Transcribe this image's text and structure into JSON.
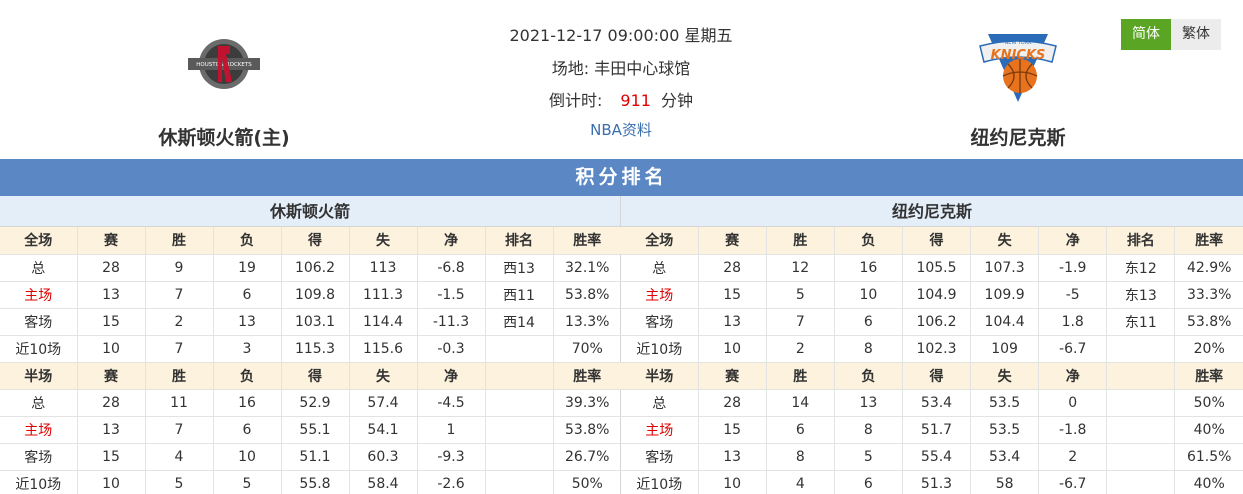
{
  "header": {
    "home_team": "休斯顿火箭(主)",
    "away_team": "纽约尼克斯",
    "datetime": "2021-12-17 09:00:00 星期五",
    "venue_label": "场地:",
    "venue": "丰田中心球馆",
    "countdown_label": "倒计时:",
    "countdown_value": "911",
    "countdown_unit": "分钟",
    "nba_link": "NBA资料",
    "home_logo_text": "HOUSTON ROCKETS",
    "away_logo_text_top": "NEW YORK",
    "away_logo_text": "KNICKS"
  },
  "lang": {
    "simplified": "简体",
    "traditional": "繁体"
  },
  "colors": {
    "accent_green": "#5aa624",
    "header_blue": "#5b88c5",
    "red": "#e00000"
  },
  "standings": {
    "title": "积分排名",
    "home": {
      "name": "休斯顿火箭",
      "full_headers": [
        "全场",
        "赛",
        "胜",
        "负",
        "得",
        "失",
        "净",
        "排名",
        "胜率"
      ],
      "full_rows": [
        [
          "总",
          "28",
          "9",
          "19",
          "106.2",
          "113",
          "-6.8",
          "西13",
          "32.1%"
        ],
        [
          "主场",
          "13",
          "7",
          "6",
          "109.8",
          "111.3",
          "-1.5",
          "西11",
          "53.8%"
        ],
        [
          "客场",
          "15",
          "2",
          "13",
          "103.1",
          "114.4",
          "-11.3",
          "西14",
          "13.3%"
        ],
        [
          "近10场",
          "10",
          "7",
          "3",
          "115.3",
          "115.6",
          "-0.3",
          "",
          "70%"
        ]
      ],
      "half_headers": [
        "半场",
        "赛",
        "胜",
        "负",
        "得",
        "失",
        "净",
        "",
        "胜率"
      ],
      "half_rows": [
        [
          "总",
          "28",
          "11",
          "16",
          "52.9",
          "57.4",
          "-4.5",
          "",
          "39.3%"
        ],
        [
          "主场",
          "13",
          "7",
          "6",
          "55.1",
          "54.1",
          "1",
          "",
          "53.8%"
        ],
        [
          "客场",
          "15",
          "4",
          "10",
          "51.1",
          "60.3",
          "-9.3",
          "",
          "26.7%"
        ],
        [
          "近10场",
          "10",
          "5",
          "5",
          "55.8",
          "58.4",
          "-2.6",
          "",
          "50%"
        ]
      ]
    },
    "away": {
      "name": "纽约尼克斯",
      "full_headers": [
        "全场",
        "赛",
        "胜",
        "负",
        "得",
        "失",
        "净",
        "排名",
        "胜率"
      ],
      "full_rows": [
        [
          "总",
          "28",
          "12",
          "16",
          "105.5",
          "107.3",
          "-1.9",
          "东12",
          "42.9%"
        ],
        [
          "主场",
          "15",
          "5",
          "10",
          "104.9",
          "109.9",
          "-5",
          "东13",
          "33.3%"
        ],
        [
          "客场",
          "13",
          "7",
          "6",
          "106.2",
          "104.4",
          "1.8",
          "东11",
          "53.8%"
        ],
        [
          "近10场",
          "10",
          "2",
          "8",
          "102.3",
          "109",
          "-6.7",
          "",
          "20%"
        ]
      ],
      "half_headers": [
        "半场",
        "赛",
        "胜",
        "负",
        "得",
        "失",
        "净",
        "",
        "胜率"
      ],
      "half_rows": [
        [
          "总",
          "28",
          "14",
          "13",
          "53.4",
          "53.5",
          "0",
          "",
          "50%"
        ],
        [
          "主场",
          "15",
          "6",
          "8",
          "51.7",
          "53.5",
          "-1.8",
          "",
          "40%"
        ],
        [
          "客场",
          "13",
          "8",
          "5",
          "55.4",
          "53.4",
          "2",
          "",
          "61.5%"
        ],
        [
          "近10场",
          "10",
          "4",
          "6",
          "51.3",
          "58",
          "-6.7",
          "",
          "40%"
        ]
      ]
    }
  }
}
